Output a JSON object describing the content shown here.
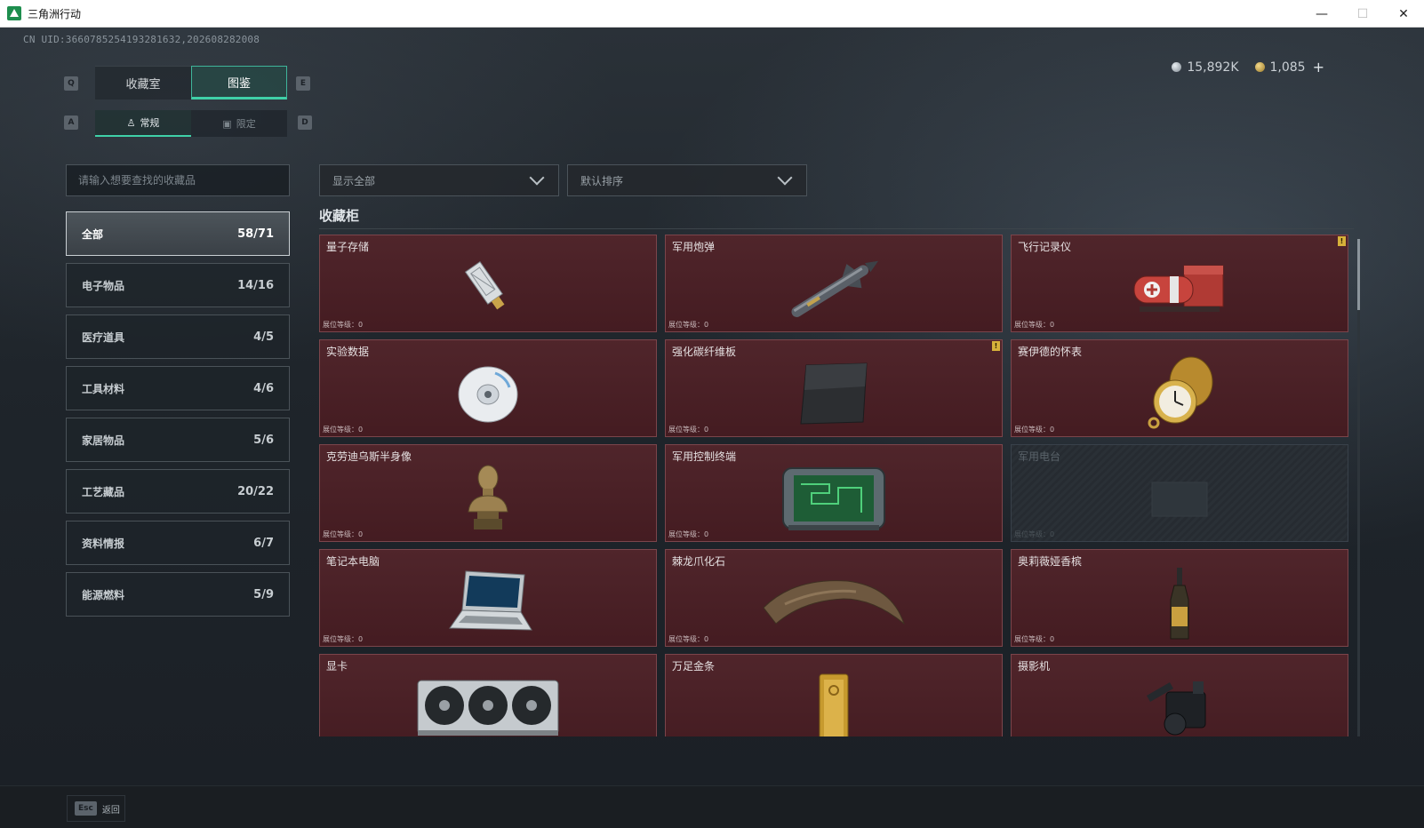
{
  "window": {
    "title": "三角洲行动",
    "minimize": "—",
    "maximize": "☐",
    "close": "✕"
  },
  "uid": "CN UID:3660785254193281632,202608282008",
  "currency": {
    "silver": "15,892K",
    "gold": "1,085",
    "plus": "+"
  },
  "keys": {
    "prev_tab": "Q",
    "next_tab": "E",
    "prev_sub": "A",
    "next_sub": "D"
  },
  "tabs": [
    {
      "label": "收藏室",
      "active": false
    },
    {
      "label": "图鉴",
      "active": true
    }
  ],
  "sub_tabs": [
    {
      "label": "常规",
      "icon": "figure-icon",
      "active": true
    },
    {
      "label": "限定",
      "icon": "image-icon",
      "active": false
    }
  ],
  "search": {
    "placeholder": "请输入想要查找的收藏品"
  },
  "filters": {
    "display": "显示全部",
    "sort": "默认排序"
  },
  "categories": [
    {
      "label": "全部",
      "count": "58/71",
      "active": true
    },
    {
      "label": "电子物品",
      "count": "14/16"
    },
    {
      "label": "医疗道具",
      "count": "4/5"
    },
    {
      "label": "工具材料",
      "count": "4/6"
    },
    {
      "label": "家居物品",
      "count": "5/6"
    },
    {
      "label": "工艺藏品",
      "count": "20/22"
    },
    {
      "label": "资料情报",
      "count": "6/7"
    },
    {
      "label": "能源燃料",
      "count": "5/9"
    }
  ],
  "section_title": "收藏柜",
  "level_label": "展位等级：0",
  "items": [
    {
      "name": "量子存储",
      "icon": "usb-drive-icon",
      "locked": false,
      "flag": false
    },
    {
      "name": "军用炮弹",
      "icon": "missile-icon",
      "locked": false,
      "flag": false
    },
    {
      "name": "飞行记录仪",
      "icon": "flight-recorder-icon",
      "locked": false,
      "flag": true
    },
    {
      "name": "实验数据",
      "icon": "disc-icon",
      "locked": false,
      "flag": false
    },
    {
      "name": "强化碳纤维板",
      "icon": "carbon-plate-icon",
      "locked": false,
      "flag": true
    },
    {
      "name": "赛伊德的怀表",
      "icon": "pocket-watch-icon",
      "locked": false,
      "flag": false
    },
    {
      "name": "克劳迪乌斯半身像",
      "icon": "bust-icon",
      "locked": false,
      "flag": false
    },
    {
      "name": "军用控制终端",
      "icon": "terminal-icon",
      "locked": false,
      "flag": false
    },
    {
      "name": "军用电台",
      "icon": "radio-icon",
      "locked": true,
      "flag": false
    },
    {
      "name": "笔记本电脑",
      "icon": "laptop-icon",
      "locked": false,
      "flag": false
    },
    {
      "name": "棘龙爪化石",
      "icon": "claw-fossil-icon",
      "locked": false,
      "flag": false
    },
    {
      "name": "奥莉薇娅香槟",
      "icon": "champagne-icon",
      "locked": false,
      "flag": false
    },
    {
      "name": "显卡",
      "icon": "graphics-card-icon",
      "locked": false,
      "flag": false
    },
    {
      "name": "万足金条",
      "icon": "gold-bar-icon",
      "locked": false,
      "flag": false
    },
    {
      "name": "摄影机",
      "icon": "camera-icon",
      "locked": false,
      "flag": false
    }
  ],
  "flag_mark": "!",
  "bottom": {
    "esc_key": "Esc",
    "esc_label": "返回"
  }
}
